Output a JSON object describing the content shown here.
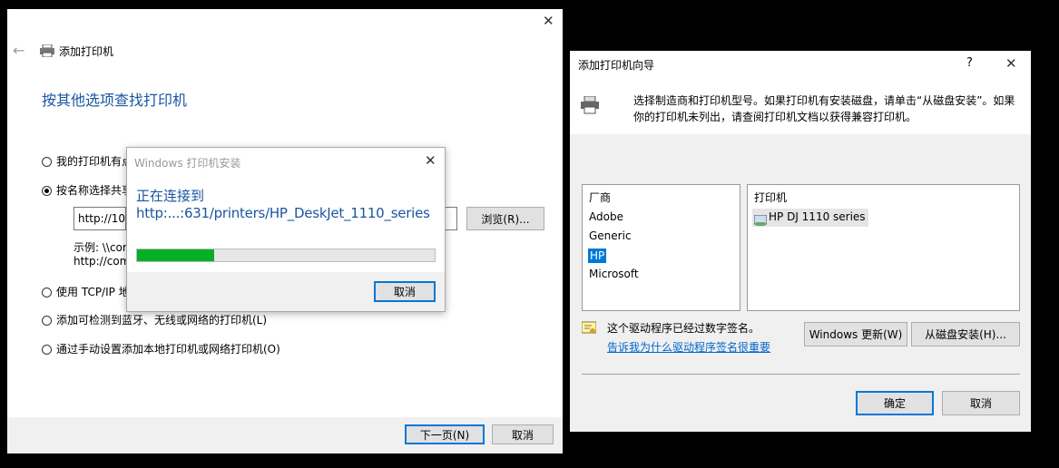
{
  "left_wizard": {
    "title": "添加打印机",
    "heading": "按其他选项查找打印机",
    "options": [
      {
        "label": "我的打印机有点",
        "selected": false
      },
      {
        "label": "按名称选择共享",
        "selected": true
      },
      {
        "label": "使用 TCP/IP 地",
        "selected": false
      },
      {
        "label": "添加可检测到蓝牙、无线或网络的打印机(L)",
        "selected": false
      },
      {
        "label": "通过手动设置添加本地打印机或网络打印机(O)",
        "selected": false
      }
    ],
    "url_value": "http://10.",
    "browse_label": "浏览(R)...",
    "example_line1": "示例: \\\\cor",
    "example_line2": "http://com",
    "next_label": "下一页(N)",
    "cancel_label": "取消"
  },
  "progress_dialog": {
    "title": "Windows 打印机安装",
    "connecting_label": "正在连接到",
    "url": "http:...:631/printers/HP_DeskJet_1110_series",
    "progress": 0.26,
    "cancel_label": "取消"
  },
  "driver_wizard": {
    "title": "添加打印机向导",
    "help_glyph": "?",
    "description_line1": "选择制造商和打印机型号。如果打印机有安装磁盘，请单击“从磁盘安装”。如果",
    "description_line2": "你的打印机未列出，请查阅打印机文档以获得兼容打印机。",
    "manufacturer_header": "厂商",
    "manufacturers": [
      "Adobe",
      "Generic",
      "HP",
      "Microsoft"
    ],
    "selected_manufacturer": "HP",
    "printer_header": "打印机",
    "printers": [
      "HP DJ 1110 series"
    ],
    "signed_text": "这个驱动程序已经过数字签名。",
    "signing_link": "告诉我为什么驱动程序签名很重要",
    "windows_update_label": "Windows 更新(W)",
    "have_disk_label": "从磁盘安装(H)...",
    "ok_label": "确定",
    "cancel_label": "取消"
  },
  "colors": {
    "accent": "#0078d7",
    "heading": "#1a56a0",
    "progress": "#06b025"
  }
}
